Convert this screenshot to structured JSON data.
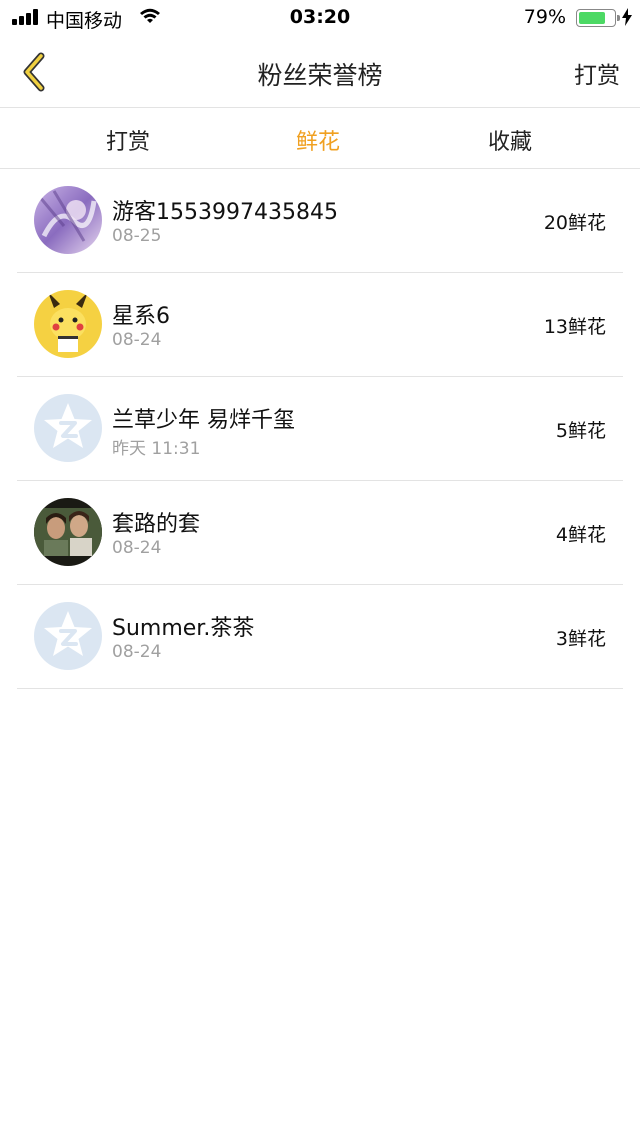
{
  "status_bar": {
    "carrier": "中国移动",
    "time": "03:20",
    "battery_percent": "79%",
    "battery_level": 0.79,
    "icons": [
      "signal-icon",
      "wifi-icon",
      "battery-icon",
      "charging-icon"
    ]
  },
  "nav": {
    "title": "粉丝荣誉榜",
    "right_label": "打赏",
    "back_icon": "chevron-left-icon",
    "accent_color": "#f0c030"
  },
  "tabs": [
    {
      "label": "打赏",
      "active": false
    },
    {
      "label": "鲜花",
      "active": true
    },
    {
      "label": "收藏",
      "active": false
    }
  ],
  "active_tab_color": "#f0a020",
  "rows": [
    {
      "name": "游客1553997435845",
      "date": "08-25",
      "amount": "20鲜花",
      "avatar": "anime-illustration-avatar"
    },
    {
      "name": "星系6",
      "date": "08-24",
      "amount": "13鲜花",
      "avatar": "pikachu-avatar"
    },
    {
      "name": "兰草少年 易烊千玺",
      "date": "昨天 11:31",
      "amount": "5鲜花",
      "avatar": "default-qzone-avatar"
    },
    {
      "name": "套路的套",
      "date": "08-24",
      "amount": "4鲜花",
      "avatar": "photo-avatar"
    },
    {
      "name": "Summer.茶茶",
      "date": "08-24",
      "amount": "3鲜花",
      "avatar": "default-qzone-avatar"
    }
  ]
}
